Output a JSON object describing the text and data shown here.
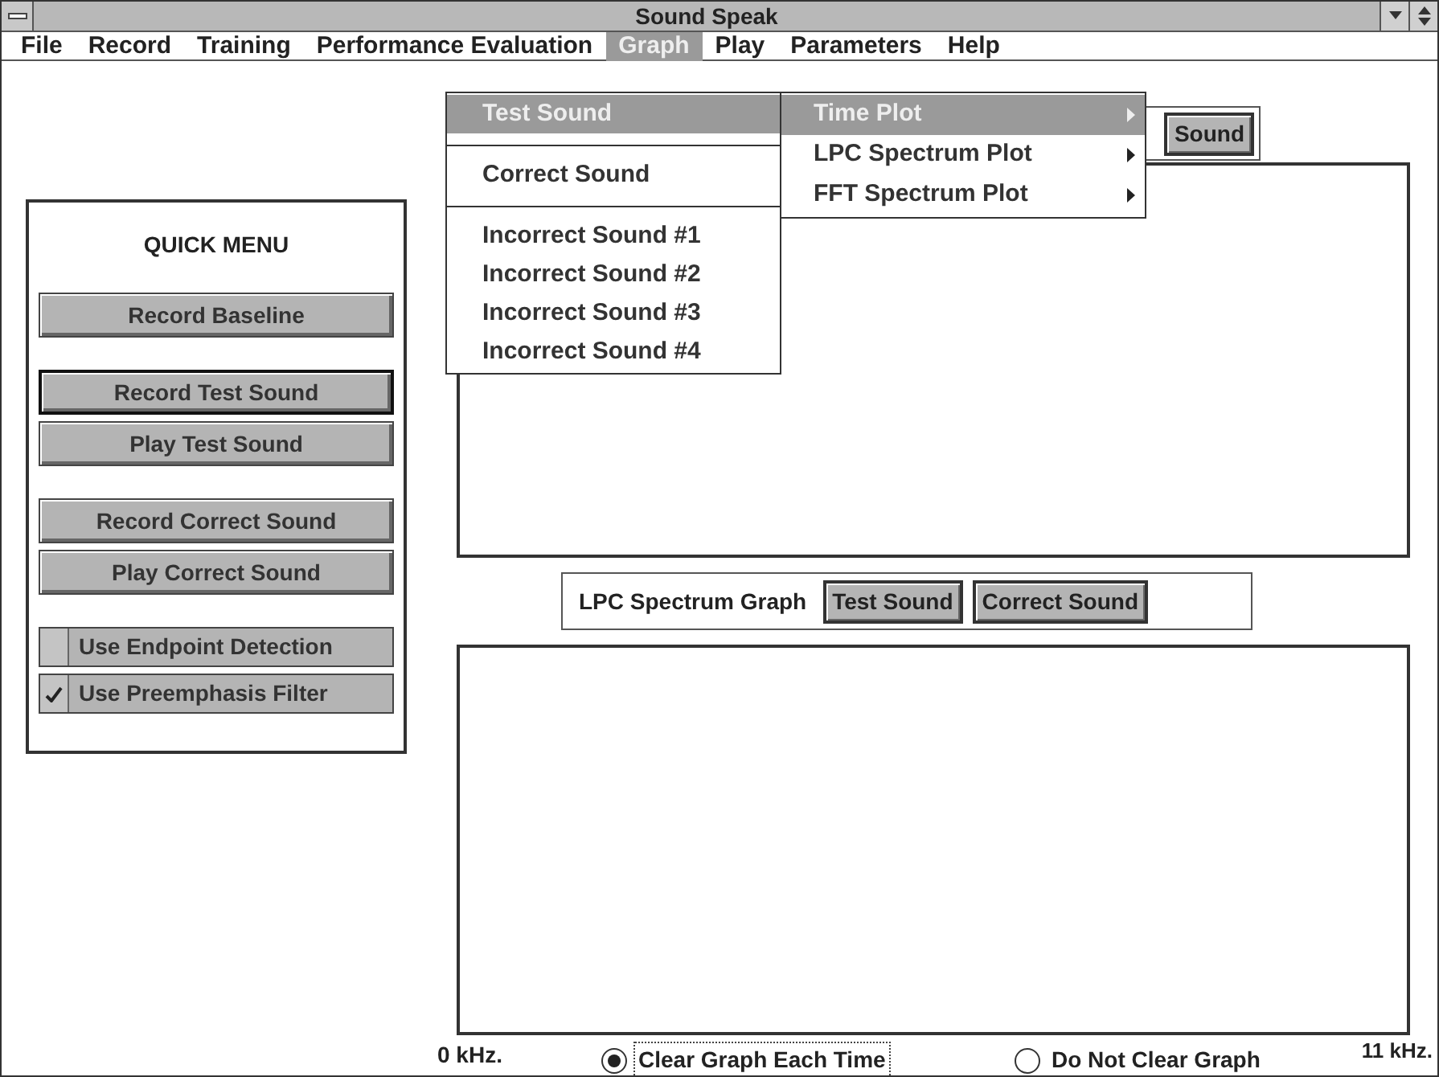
{
  "window": {
    "title": "Sound Speak"
  },
  "menu_bar": [
    {
      "label": "File",
      "selected": false
    },
    {
      "label": "Record",
      "selected": false
    },
    {
      "label": "Training",
      "selected": false
    },
    {
      "label": "Performance Evaluation",
      "selected": false
    },
    {
      "label": "Graph",
      "selected": true
    },
    {
      "label": "Play",
      "selected": false
    },
    {
      "label": "Parameters",
      "selected": false
    },
    {
      "label": "Help",
      "selected": false
    }
  ],
  "graph_menu": [
    {
      "kind": "item",
      "label": "Test Sound",
      "selected": true
    },
    {
      "kind": "separator"
    },
    {
      "kind": "item",
      "label": "Correct Sound",
      "selected": false
    },
    {
      "kind": "separator"
    },
    {
      "kind": "item",
      "label": "Incorrect Sound #1",
      "selected": false
    },
    {
      "kind": "item",
      "label": "Incorrect Sound #2",
      "selected": false
    },
    {
      "kind": "item",
      "label": "Incorrect Sound #3",
      "selected": false
    },
    {
      "kind": "item",
      "label": "Incorrect Sound #4",
      "selected": false
    }
  ],
  "graph_submenu": [
    {
      "label": "Time Plot",
      "selected": true
    },
    {
      "label": "LPC Spectrum Plot",
      "selected": false
    },
    {
      "label": "FFT Spectrum Plot",
      "selected": false
    }
  ],
  "quick_menu": {
    "title": "QUICK MENU",
    "groups": [
      [
        {
          "kind": "button",
          "label": "Record Baseline",
          "default": false
        }
      ],
      [
        {
          "kind": "button",
          "label": "Record Test Sound",
          "default": true
        },
        {
          "kind": "button",
          "label": "Play Test Sound",
          "default": false
        }
      ],
      [
        {
          "kind": "button",
          "label": "Record Correct Sound",
          "default": false
        },
        {
          "kind": "button",
          "label": "Play Correct Sound",
          "default": false
        }
      ],
      [
        {
          "kind": "checkbox",
          "label": "Use Endpoint Detection",
          "checked": false
        },
        {
          "kind": "checkbox",
          "label": "Use Preemphasis Filter",
          "checked": true
        }
      ]
    ]
  },
  "time_graph": {
    "buttons": [
      "Sound"
    ]
  },
  "lpc_graph": {
    "title": "LPC Spectrum Graph",
    "buttons": [
      "Test Sound",
      "Correct Sound"
    ]
  },
  "axis": {
    "min_label": "0 kHz.",
    "max_label": "11 kHz."
  },
  "clear_options": [
    {
      "label": "Clear Graph Each Time",
      "selected": true
    },
    {
      "label": "Do Not Clear Graph",
      "selected": false
    }
  ]
}
